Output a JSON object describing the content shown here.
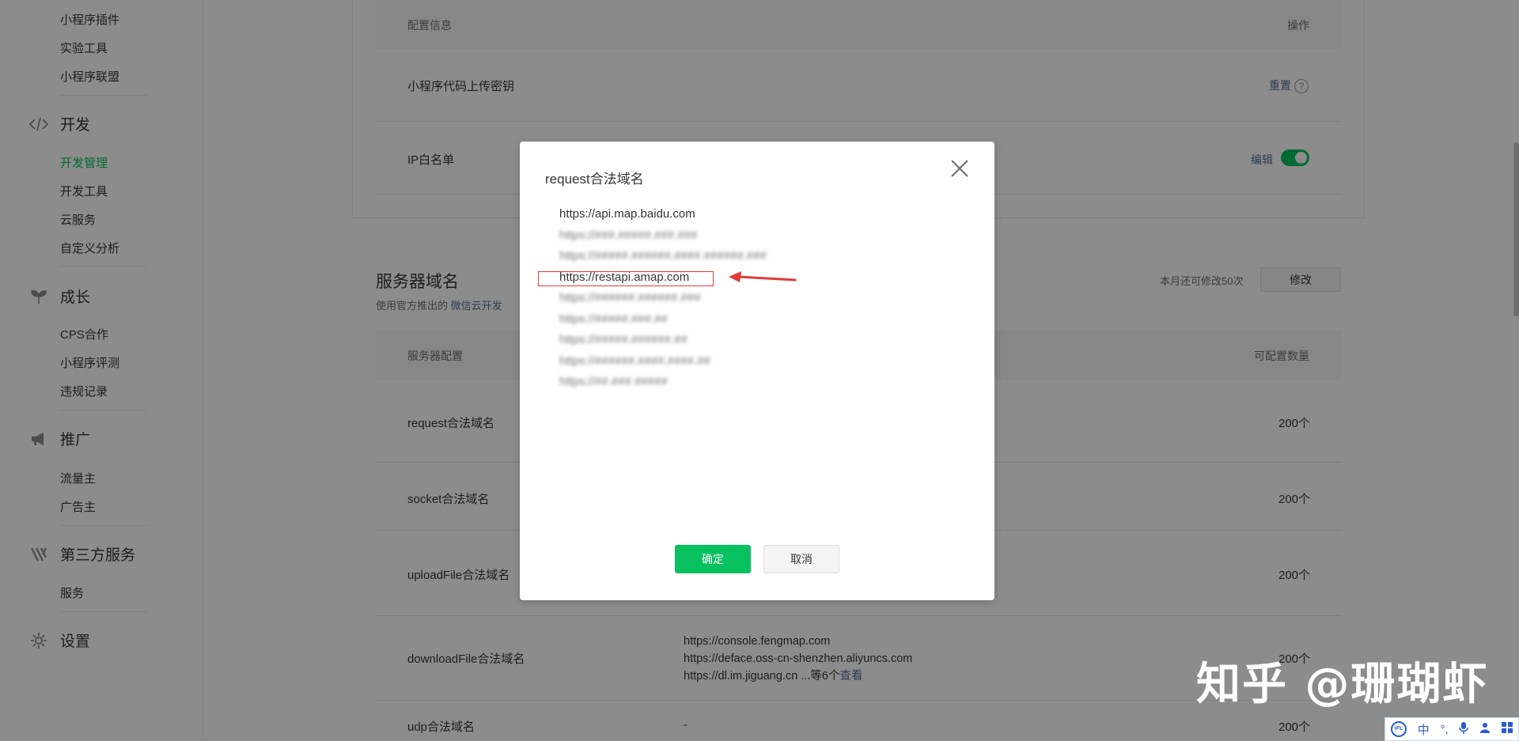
{
  "sidebar": {
    "pre_items": [
      "小程序插件",
      "实验工具",
      "小程序联盟"
    ],
    "groups": [
      {
        "label": "开发",
        "icon": "code-icon",
        "items": [
          "开发管理",
          "开发工具",
          "云服务",
          "自定义分析"
        ],
        "active": "开发管理"
      },
      {
        "label": "成长",
        "icon": "sprout-icon",
        "items": [
          "CPS合作",
          "小程序评测",
          "违规记录"
        ]
      },
      {
        "label": "推广",
        "icon": "megaphone-icon",
        "items": [
          "流量主",
          "广告主"
        ]
      },
      {
        "label": "第三方服务",
        "icon": "third-party-icon",
        "items": [
          "服务"
        ]
      },
      {
        "label": "设置",
        "icon": "gear-icon",
        "items": []
      }
    ]
  },
  "config_table": {
    "header_left": "配置信息",
    "header_right": "操作",
    "rows": [
      {
        "label": "小程序代码上传密钥",
        "action": "重置"
      },
      {
        "label": "IP白名单",
        "action": "编辑",
        "toggle": true
      }
    ]
  },
  "server_domain": {
    "title": "服务器域名",
    "subtitle_prefix": "使用官方推出的",
    "subtitle_link": "微信云开发",
    "subtitle_suffix": "",
    "count_note": "本月还可修改50次",
    "modify_label": "修改",
    "header_left": "服务器配置",
    "header_right": "可配置数量",
    "rows": [
      {
        "label": "request合法域名",
        "count": "200个"
      },
      {
        "label": "socket合法域名",
        "count": "200个"
      },
      {
        "label": "uploadFile合法域名",
        "count": "200个"
      },
      {
        "label": "downloadFile合法域名",
        "count": "200个",
        "domains": [
          "https://console.fengmap.com",
          "https://deface.oss-cn-shenzhen.aliyuncs.com",
          "https://dl.im.jiguang.cn"
        ],
        "more_text": "...等6个",
        "more_link": "查看"
      },
      {
        "label": "udp合法域名",
        "count": "200个",
        "domains_text": "-"
      }
    ]
  },
  "dialog": {
    "title": "request合法域名",
    "domains": [
      {
        "text": "https://api.map.baidu.com",
        "blurred": false
      },
      {
        "text": "https://###.#####.###.###",
        "blurred": true
      },
      {
        "text": "https://#####.######.####.######.###",
        "blurred": true
      },
      {
        "text": "https://restapi.amap.com",
        "blurred": false,
        "highlighted": true
      },
      {
        "text": "https://######.######.###",
        "blurred": true
      },
      {
        "text": "https://#####.###.##",
        "blurred": true
      },
      {
        "text": "https://#####.######.##",
        "blurred": true
      },
      {
        "text": "https://######.####.####.##",
        "blurred": true
      },
      {
        "text": "https://##.###.#####",
        "blurred": true
      }
    ],
    "ok_label": "确定",
    "cancel_label": "取消"
  },
  "watermark": "知乎 @珊瑚虾",
  "ime": {
    "items": [
      "中",
      "°,",
      "mic-icon",
      "user-icon",
      "grid-icon"
    ]
  },
  "colors": {
    "accent": "#07c160",
    "link": "#576b95",
    "highlight": "#e03b3b"
  }
}
